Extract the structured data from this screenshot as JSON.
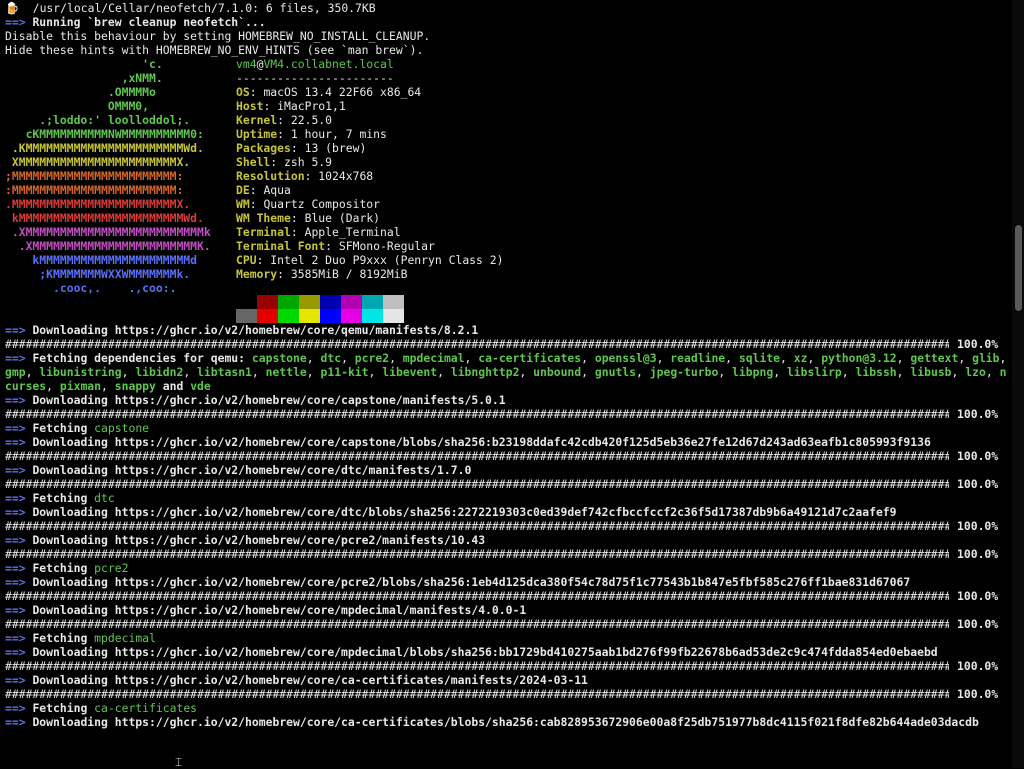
{
  "header_lines": {
    "line1": "/usr/local/Cellar/neofetch/7.1.0: 6 files, 350.7KB",
    "line2": "Running `brew cleanup neofetch`...",
    "line3": "Disable this behaviour by setting HOMEBREW_NO_INSTALL_CLEANUP.",
    "line4": "Hide these hints with HOMEBREW_NO_ENV_HINTS (see `man brew`)."
  },
  "neofetch": {
    "user": "vm4",
    "host": "VM4.collabnet.local",
    "separator": "-----------------------",
    "fields": [
      {
        "key": "OS",
        "value": "macOS 13.4 22F66 x86_64"
      },
      {
        "key": "Host",
        "value": "iMacPro1,1"
      },
      {
        "key": "Kernel",
        "value": "22.5.0"
      },
      {
        "key": "Uptime",
        "value": "1 hour, 7 mins"
      },
      {
        "key": "Packages",
        "value": "13 (brew)"
      },
      {
        "key": "Shell",
        "value": "zsh 5.9"
      },
      {
        "key": "Resolution",
        "value": "1024x768"
      },
      {
        "key": "DE",
        "value": "Aqua"
      },
      {
        "key": "WM",
        "value": "Quartz Compositor"
      },
      {
        "key": "WM Theme",
        "value": "Blue (Dark)"
      },
      {
        "key": "Terminal",
        "value": "Apple_Terminal"
      },
      {
        "key": "Terminal Font",
        "value": "SFMono-Regular"
      },
      {
        "key": "CPU",
        "value": "Intel 2 Duo P9xxx (Penryn Class 2)"
      },
      {
        "key": "Memory",
        "value": "3585MiB / 8192MiB"
      }
    ],
    "logo": [
      {
        "text": "                    'c.",
        "color": "#5fc64f"
      },
      {
        "text": "                 ,xNMM.",
        "color": "#5fc64f"
      },
      {
        "text": "               .OMMMMo",
        "color": "#5fc64f"
      },
      {
        "text": "               OMMM0,",
        "color": "#5fc64f"
      },
      {
        "text": "     .;loddo:' loolloddol;.",
        "color": "#5fc64f"
      },
      {
        "text": "   cKMMMMMMMMMMNWMMMMMMMMMM0:",
        "color": "#5fc64f"
      },
      {
        "text": " .KMMMMMMMMMMMMMMMMMMMMMMMWd.",
        "color": "#c7c43a"
      },
      {
        "text": " XMMMMMMMMMMMMMMMMMMMMMMMX.",
        "color": "#c7c43a"
      },
      {
        "text": ";MMMMMMMMMMMMMMMMMMMMMMMM:",
        "color": "#d4662a"
      },
      {
        "text": ":MMMMMMMMMMMMMMMMMMMMMMMM:",
        "color": "#d4662a"
      },
      {
        "text": ".MMMMMMMMMMMMMMMMMMMMMMMMX.",
        "color": "#d93b3b"
      },
      {
        "text": " kMMMMMMMMMMMMMMMMMMMMMMMMWd.",
        "color": "#d93b3b"
      },
      {
        "text": " .XMMMMMMMMMMMMMMMMMMMMMMMMMMk",
        "color": "#c24fc2"
      },
      {
        "text": "  .XMMMMMMMMMMMMMMMMMMMMMMMMK.",
        "color": "#c24fc2"
      },
      {
        "text": "    kMMMMMMMMMMMMMMMMMMMMMMd",
        "color": "#5c6ef5"
      },
      {
        "text": "     ;KMMMMMMMWXXWMMMMMMMk.",
        "color": "#5c6ef5"
      },
      {
        "text": "       .cooc,.    .,coo:.",
        "color": "#5c6ef5"
      }
    ],
    "palette_top": [
      "#000000",
      "#990000",
      "#00a600",
      "#999900",
      "#0000b2",
      "#b200b2",
      "#00a6b2",
      "#bfbfbf"
    ],
    "palette_bottom": [
      "#666666",
      "#e50000",
      "#00d900",
      "#e5e500",
      "#0000ff",
      "#e500e5",
      "#00e5e5",
      "#e5e5e5"
    ]
  },
  "log": [
    {
      "type": "dl",
      "text": "Downloading https://ghcr.io/v2/homebrew/core/qemu/manifests/8.2.1"
    },
    {
      "type": "bar",
      "pct": "100.0%"
    },
    {
      "type": "deps",
      "prefix": "Fetching dependencies for qemu: ",
      "items": [
        "capstone",
        "dtc",
        "pcre2",
        "mpdecimal",
        "ca-certificates",
        "openssl@3",
        "readline",
        "sqlite",
        "xz",
        "python@3.12",
        "gettext",
        "glib",
        "gmp",
        "libunistring",
        "libidn2",
        "libtasn1",
        "nettle",
        "p11-kit",
        "libevent",
        "libnghttp2",
        "unbound",
        "gnutls",
        "jpeg-turbo",
        "libpng",
        "libslirp",
        "libssh",
        "libusb",
        "lzo",
        "ncurses",
        "pixman",
        "snappy",
        "vde"
      ],
      "and_word": "and"
    },
    {
      "type": "dl",
      "text": "Downloading https://ghcr.io/v2/homebrew/core/capstone/manifests/5.0.1"
    },
    {
      "type": "bar",
      "pct": "100.0%"
    },
    {
      "type": "fetch",
      "label": "Fetching ",
      "name": "capstone"
    },
    {
      "type": "dl",
      "text": "Downloading https://ghcr.io/v2/homebrew/core/capstone/blobs/sha256:b23198ddafc42cdb420f125d5eb36e27fe12d67d243ad63eafb1c805993f9136"
    },
    {
      "type": "bar",
      "pct": "100.0%"
    },
    {
      "type": "dl",
      "text": "Downloading https://ghcr.io/v2/homebrew/core/dtc/manifests/1.7.0"
    },
    {
      "type": "bar",
      "pct": "100.0%"
    },
    {
      "type": "fetch",
      "label": "Fetching ",
      "name": "dtc"
    },
    {
      "type": "dl",
      "text": "Downloading https://ghcr.io/v2/homebrew/core/dtc/blobs/sha256:2272219303c0ed39def742cfbccfccf2c36f5d17387db9b6a49121d7c2aafef9"
    },
    {
      "type": "bar",
      "pct": "100.0%"
    },
    {
      "type": "dl",
      "text": "Downloading https://ghcr.io/v2/homebrew/core/pcre2/manifests/10.43"
    },
    {
      "type": "bar",
      "pct": "100.0%"
    },
    {
      "type": "fetch",
      "label": "Fetching ",
      "name": "pcre2"
    },
    {
      "type": "dl",
      "text": "Downloading https://ghcr.io/v2/homebrew/core/pcre2/blobs/sha256:1eb4d125dca380f54c78d75f1c77543b1b847e5fbf585c276ff1bae831d67067"
    },
    {
      "type": "bar",
      "pct": "100.0%"
    },
    {
      "type": "dl",
      "text": "Downloading https://ghcr.io/v2/homebrew/core/mpdecimal/manifests/4.0.0-1"
    },
    {
      "type": "bar",
      "pct": "100.0%"
    },
    {
      "type": "fetch",
      "label": "Fetching ",
      "name": "mpdecimal"
    },
    {
      "type": "dl",
      "text": "Downloading https://ghcr.io/v2/homebrew/core/mpdecimal/blobs/sha256:bb1729bd410275aab1bd276f99fb22678b6ad53de2c9c474fdda854ed0ebaebd"
    },
    {
      "type": "bar",
      "pct": "100.0%"
    },
    {
      "type": "dl",
      "text": "Downloading https://ghcr.io/v2/homebrew/core/ca-certificates/manifests/2024-03-11"
    },
    {
      "type": "bar",
      "pct": "100.0%"
    },
    {
      "type": "fetch",
      "label": "Fetching ",
      "name": "ca-certificates"
    },
    {
      "type": "dl",
      "text": "Downloading https://ghcr.io/v2/homebrew/core/ca-certificates/blobs/sha256:cab828953672906e00a8f25db751977b8dc4115f021f8dfe82b644ade03dacdb"
    }
  ],
  "arrow": "==>",
  "hashes": "##########################################################################################################################################",
  "icons": {
    "beer": "beer-mug-icon",
    "cursor": "mouse-cursor-icon"
  },
  "scroll_position": 0.33
}
